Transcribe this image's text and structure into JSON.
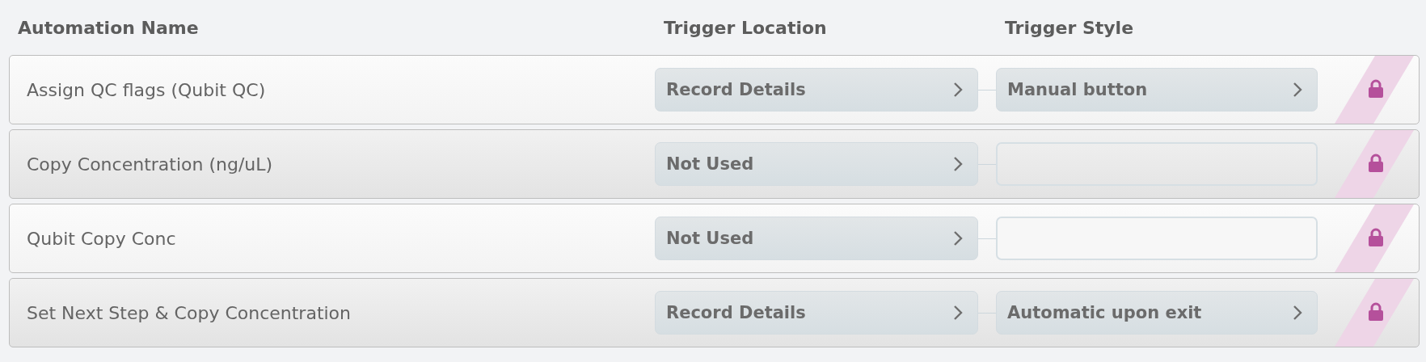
{
  "columns": [
    "Automation Name",
    "Trigger Location",
    "Trigger Style"
  ],
  "rows": [
    {
      "name": "Assign QC flags (Qubit QC)",
      "trigger_location": "Record Details",
      "trigger_style": {
        "kind": "button",
        "label": "Manual button"
      },
      "locked": true
    },
    {
      "name": "Copy Concentration (ng/uL)",
      "trigger_location": "Not Used",
      "trigger_style": {
        "kind": "empty"
      },
      "locked": true
    },
    {
      "name": "Qubit Copy Conc",
      "trigger_location": "Not Used",
      "trigger_style": {
        "kind": "empty"
      },
      "locked": true
    },
    {
      "name": "Set Next Step & Copy Concentration",
      "trigger_location": "Record Details",
      "trigger_style": {
        "kind": "button",
        "label": "Automatic upon exit"
      },
      "locked": true
    }
  ]
}
